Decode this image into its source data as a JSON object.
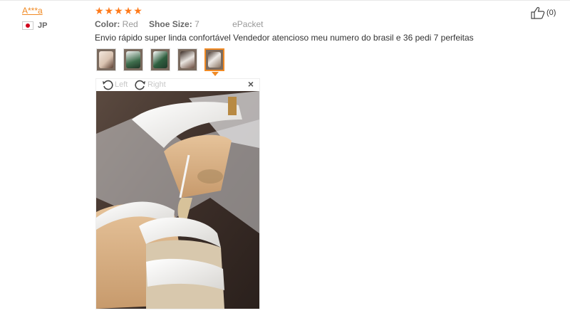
{
  "review": {
    "reviewer": "A***a",
    "country_code": "JP",
    "rating": 5,
    "color_label": "Color:",
    "color_value": "Red",
    "size_label": "Shoe Size:",
    "size_value": "7",
    "shipping": "ePacket",
    "text": "Envio rápido super linda confortável Vendedor atencioso meu numero do brasil e 36 pedi 7 perfeitas",
    "helpful_count": "(0)"
  },
  "gallery": {
    "thumbnails": [
      {
        "tone": "#d9c2b0"
      },
      {
        "tone": "#3f6e4d"
      },
      {
        "tone": "#2f5f3f"
      },
      {
        "tone": "#e9e4df"
      },
      {
        "tone": "#eeeae6"
      }
    ],
    "selected_index": 4
  },
  "viewer": {
    "rotate_left": "Left",
    "rotate_right": "Right",
    "close": "×"
  },
  "colors": {
    "accent": "#f08a24",
    "star": "#ff7a1a"
  }
}
